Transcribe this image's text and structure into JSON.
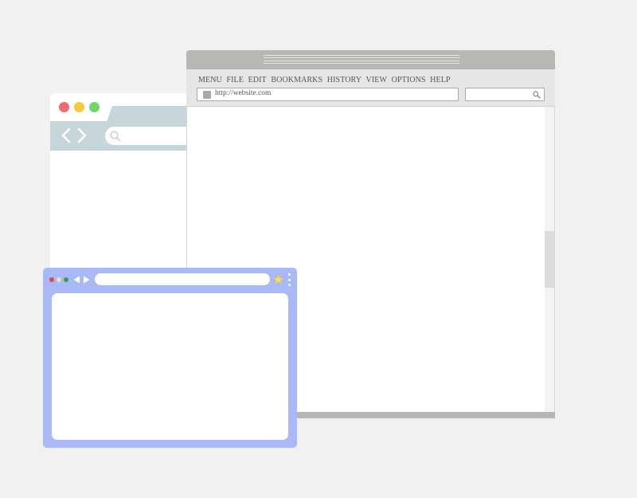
{
  "back_window": {
    "traffic_colors": [
      "#ee6b6f",
      "#f4cb3b",
      "#6fd86a"
    ],
    "accent": "#c7d6db",
    "icons": [
      "back-icon",
      "forward-icon",
      "search-icon"
    ]
  },
  "main_window": {
    "menu": {
      "items": [
        "MENU",
        "FILE",
        "EDIT",
        "BOOKMARKS",
        "HISTORY",
        "VIEW",
        "OPTIONS",
        "HELP"
      ]
    },
    "address_bar": {
      "url": "http://website.com"
    },
    "icons": [
      "favicon-icon",
      "search-icon"
    ],
    "chrome_color": "#b8b7b4"
  },
  "front_window": {
    "dot_colors": [
      "#e8444a",
      "#f3e1a0",
      "#3a9b4e"
    ],
    "accent": "#a9b8f6",
    "icons": [
      "back-icon",
      "forward-icon",
      "star-icon",
      "more-vertical-icon"
    ]
  }
}
